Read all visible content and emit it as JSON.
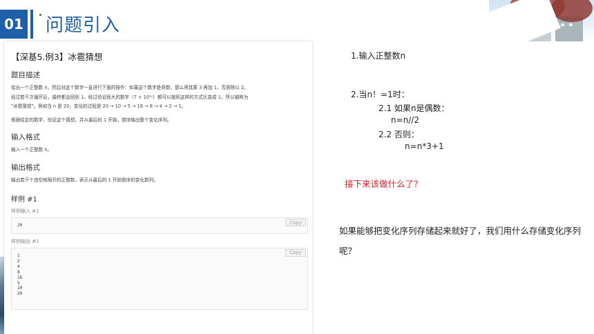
{
  "header": {
    "section_number": "01",
    "title": "问题引入"
  },
  "problem": {
    "title": "【深基5.例3】冰雹猜想",
    "description_heading": "题目描述",
    "description_lines": [
      "给出一个正整数 n，然后对这个数字一直进行下面的操作：如果这个数字是奇数，那么将其乘 3 再加 1，否则除以 2。",
      "经过若干次循环后，最终都会回到 1。经过验证很大的数字（7 × 10¹¹）都可以按照这样的方式比变成 1，所以被称为",
      "\"冰雹猜想\"。例如当 n 是 20，变化的过程是 20 → 10 → 5 → 16 → 8 → 4 → 2 → 1。"
    ],
    "description_extra": "根据给定的数字，验证这个猜想，并从最后的 1 开始，倒序输出整个变化序列。",
    "input_heading": "输入格式",
    "input_text": "输入一个正整数 n。",
    "output_heading": "输出格式",
    "output_text": "输出若干个由空格隔开的正整数，表示从最后的 1 开始倒序的变化数列。",
    "sample_heading": "样例 #1",
    "sample_input_label": "样例输入 #1",
    "sample_input": "20",
    "sample_output_label": "样例输出 #1",
    "sample_output_lines": [
      "1",
      "2",
      "4",
      "8",
      "16",
      "5",
      "10",
      "20"
    ],
    "copy_label": "Copy"
  },
  "explanation": {
    "step1": "1.输入正整数n",
    "step2": "2.当n！=1时：",
    "step2_1": "2.1   如果n是偶数：",
    "step2_1_action": "n=n//2",
    "step2_2": "2.2    否则：",
    "step2_2_action": "n=n*3+1",
    "question": "接下来该做什么了？",
    "paragraph": "如果能够把变化序列存储起来就好了，我们用什么存储变化序列呢？"
  },
  "colors": {
    "accent": "#1f5ea8",
    "question": "#e0182b"
  }
}
